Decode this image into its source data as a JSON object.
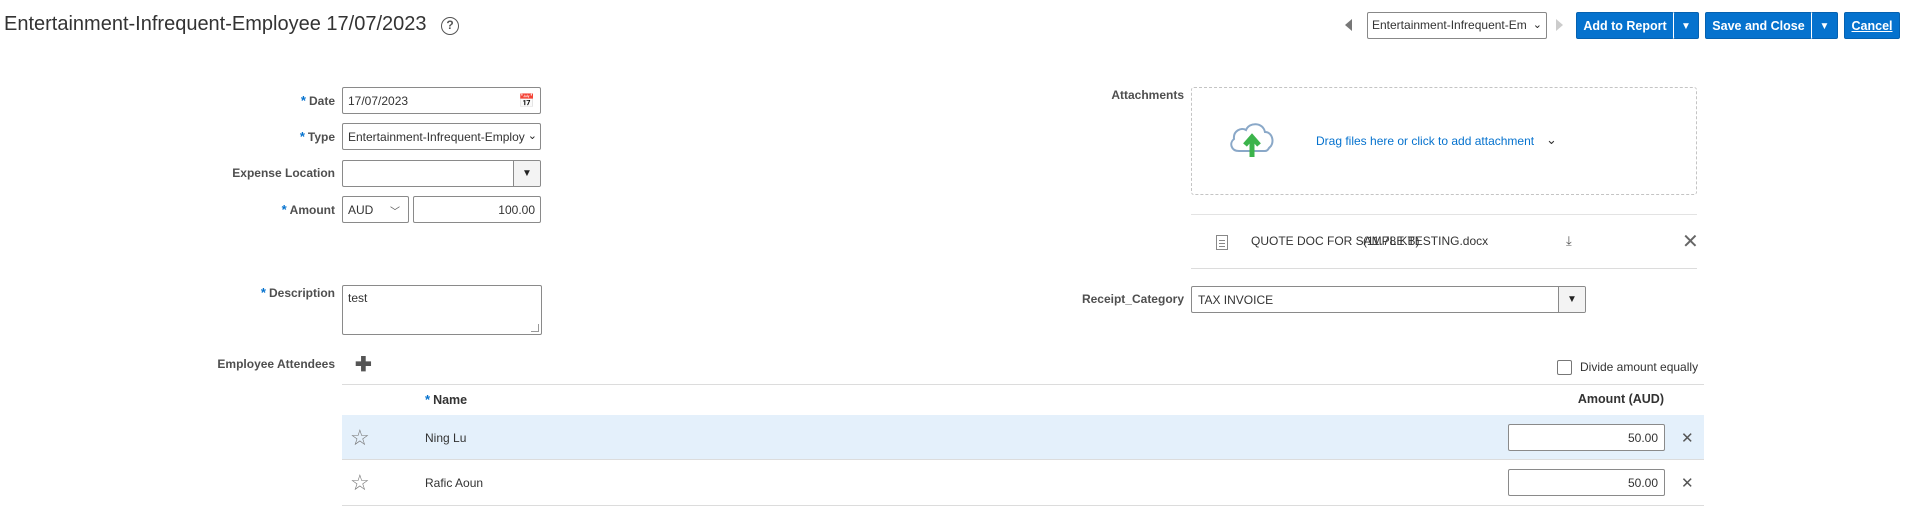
{
  "header": {
    "title": "Entertainment-Infrequent-Employee 17/07/2023",
    "item_selector_value": "Entertainment-Infrequent-Em",
    "add_to_report_label": "Add to Report",
    "save_and_close_label": "Save and Close",
    "cancel_label": "Cancel"
  },
  "form": {
    "date": {
      "label": "Date",
      "value": "17/07/2023"
    },
    "type": {
      "label": "Type",
      "value": "Entertainment-Infrequent-Employ"
    },
    "expense_location": {
      "label": "Expense Location",
      "value": ""
    },
    "amount": {
      "label": "Amount",
      "currency": "AUD",
      "value": "100.00"
    },
    "description": {
      "label": "Description",
      "value": "test"
    },
    "required_marker": "*"
  },
  "attachments": {
    "label": "Attachments",
    "drop_text": "Drag files here or click to add attachment",
    "file": {
      "name": "QUOTE DOC FOR SAMPLE TESTING.docx",
      "size": "(11.78 KB)"
    }
  },
  "receipt_category": {
    "label": "Receipt_Category",
    "value": "TAX INVOICE"
  },
  "attendees": {
    "label": "Employee Attendees",
    "divide_label": "Divide amount equally",
    "divide_checked": false,
    "columns": {
      "name": "Name",
      "amount": "Amount (AUD)"
    },
    "rows": [
      {
        "name": "Ning Lu",
        "amount": "50.00"
      },
      {
        "name": "Rafic Aoun",
        "amount": "50.00"
      }
    ]
  },
  "colors": {
    "accent": "#0572ce",
    "selected_row": "#e4f0fb",
    "upload_arrow": "#3cb44b"
  }
}
